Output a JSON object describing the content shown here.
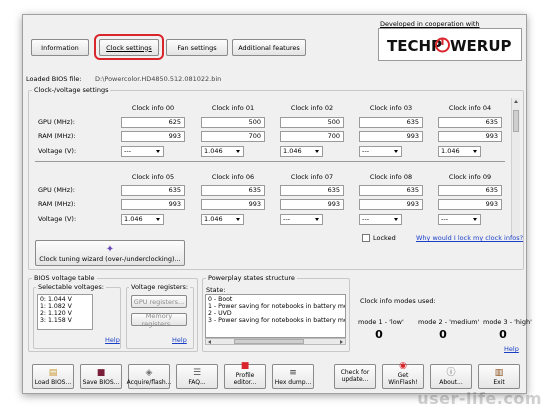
{
  "tabs": {
    "information": "Information",
    "clock_settings": "Clock settings",
    "fan_settings": "Fan settings",
    "additional_features": "Additional features"
  },
  "header": {
    "developed": "Developed in cooperation with",
    "logo_text": "TECHPOWERUP"
  },
  "bios": {
    "label": "Loaded BIOS file:",
    "path": "D:\\Powercolor.HD4850.512.081022.bin"
  },
  "clock_group": {
    "title": "Clock-/voltage settings",
    "row_labels": [
      "GPU (MHz):",
      "RAM (MHz):",
      "Voltage (V):"
    ],
    "top": [
      {
        "name": "Clock info 00",
        "gpu": "625",
        "ram": "993",
        "voltage": "---"
      },
      {
        "name": "Clock info 01",
        "gpu": "500",
        "ram": "700",
        "voltage": "1.046"
      },
      {
        "name": "Clock info 02",
        "gpu": "500",
        "ram": "700",
        "voltage": "1.046"
      },
      {
        "name": "Clock info 03",
        "gpu": "635",
        "ram": "993",
        "voltage": "---"
      },
      {
        "name": "Clock info 04",
        "gpu": "635",
        "ram": "993",
        "voltage": "1.046"
      }
    ],
    "bottom": [
      {
        "name": "Clock info 05",
        "gpu": "635",
        "ram": "993",
        "voltage": "1.046"
      },
      {
        "name": "Clock info 06",
        "gpu": "635",
        "ram": "993",
        "voltage": "1.046"
      },
      {
        "name": "Clock info 07",
        "gpu": "635",
        "ram": "993",
        "voltage": "---"
      },
      {
        "name": "Clock info 08",
        "gpu": "635",
        "ram": "993",
        "voltage": "---"
      },
      {
        "name": "Clock info 09",
        "gpu": "635",
        "ram": "993",
        "voltage": "---"
      }
    ],
    "locked": "Locked",
    "why_link": "Why would I lock my clock infos?",
    "wizard": "Clock tuning wizard (over-/underclocking)..."
  },
  "bios_voltage": {
    "title": "BIOS voltage table",
    "selectable_title": "Selectable voltages:",
    "voltages": [
      "0: 1.044 V",
      "1: 1.082 V",
      "2: 1.120 V",
      "3: 1.158 V"
    ],
    "help": "Help",
    "registers_title": "Voltage registers:",
    "gpu_registers": "GPU registers...",
    "memory_registers": "Memory registers...",
    "help2": "Help"
  },
  "powerplay": {
    "title": "Powerplay states structure",
    "state_label": "State:",
    "states": [
      "0 - Boot",
      "1 - Power saving for notebooks in battery mode, High p",
      "2 - UVD",
      "3 - Power saving for notebooks in battery mode, High p"
    ]
  },
  "clock_modes": {
    "title": "Clock info modes used:",
    "modes": [
      {
        "label": "mode 1 - 'low'",
        "value": "0"
      },
      {
        "label": "mode 2 - 'medium'",
        "value": "0"
      },
      {
        "label": "mode 3 - 'high'",
        "value": "0"
      }
    ],
    "help": "Help"
  },
  "toolbar": [
    {
      "label": "Load BIOS...",
      "icon": "open-folder-icon"
    },
    {
      "label": "Save BIOS...",
      "icon": "floppy-disk-icon"
    },
    {
      "label": "Acquire/flash...",
      "icon": "chip-icon"
    },
    {
      "label": "FAQ...",
      "icon": "document-icon"
    },
    {
      "label": "Profile editor...",
      "icon": "ati-icon"
    },
    {
      "label": "Hex dump...",
      "icon": "hex-icon"
    },
    {
      "label": "Check for update...",
      "icon": ""
    },
    {
      "label": "Get WinFlash!",
      "icon": "flash-icon"
    },
    {
      "label": "About...",
      "icon": "info-icon"
    },
    {
      "label": "Exit",
      "icon": "exit-door-icon"
    }
  ],
  "watermark": "user-life.com"
}
